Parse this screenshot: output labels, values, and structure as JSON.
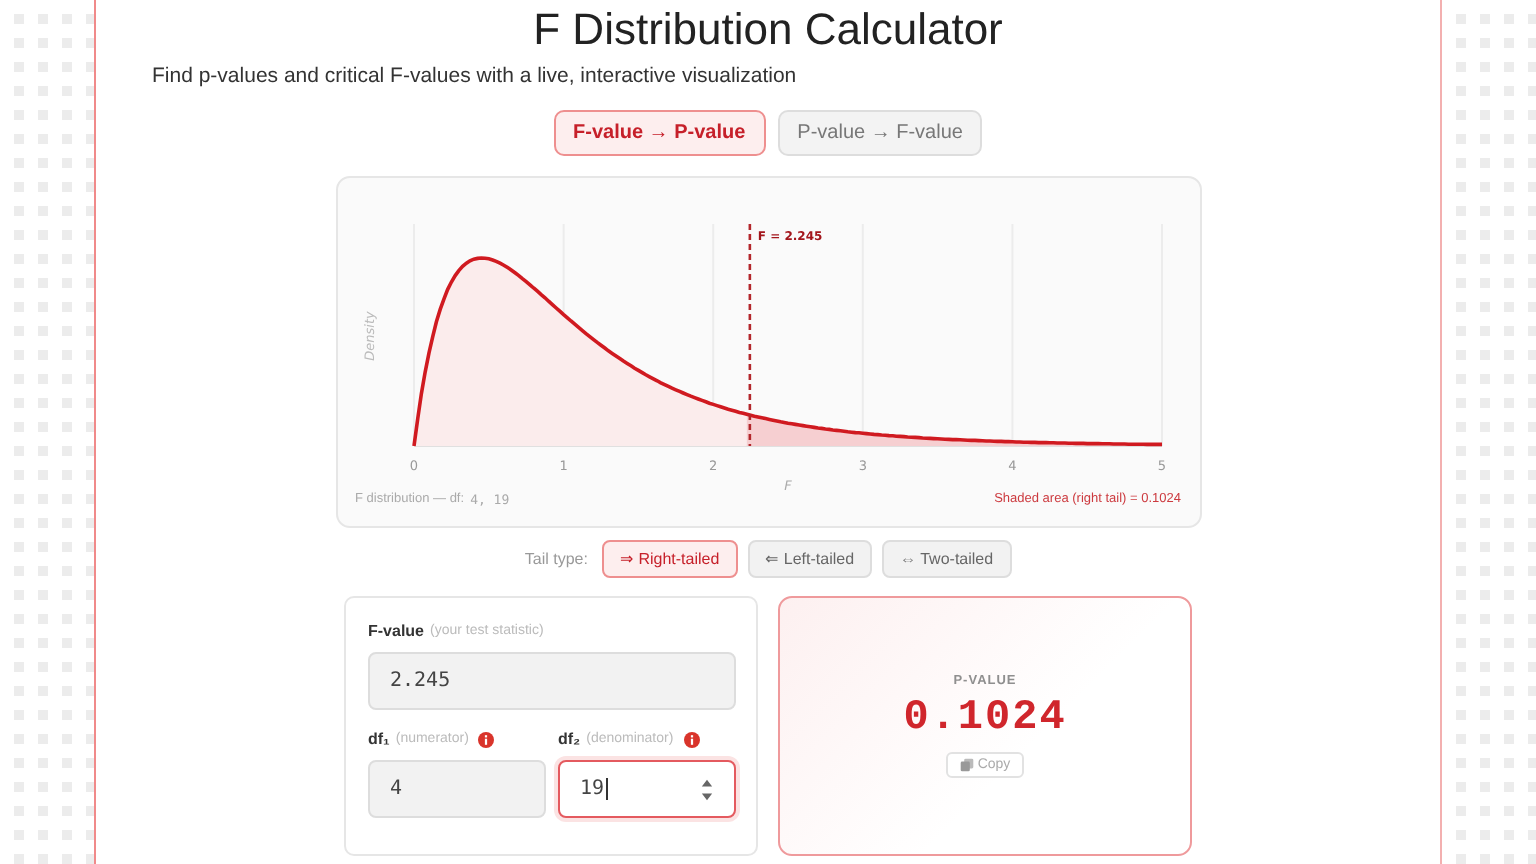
{
  "title": "F Distribution Calculator",
  "subtitle": "Find p-values and critical F-values with a live, interactive visualization",
  "modes": [
    {
      "label": "F-value → P-value",
      "selected": true
    },
    {
      "label": "P-value → F-value",
      "selected": false
    }
  ],
  "chart": {
    "xlabel": "F",
    "ylabel": "Density",
    "x_tick_labels": [
      "0",
      "1",
      "2",
      "3",
      "4",
      "5"
    ],
    "marker_label": "F = 2.245",
    "footer_label": "F distribution — df:",
    "footer_df": "4, 19",
    "shaded_label": "Shaded area (right tail) = 0.1024"
  },
  "tail": {
    "label": "Tail type:",
    "options": [
      {
        "label": "⇒ Right-tailed",
        "selected": true
      },
      {
        "label": "⇐ Left-tailed",
        "selected": false
      },
      {
        "label": "⇔ Two-tailed",
        "selected": false
      }
    ]
  },
  "inputs": {
    "f_label": "F-value",
    "f_hint": "(your test statistic)",
    "f_value": "2.245",
    "df1_label": "df₁",
    "df1_hint": "(numerator)",
    "df1_value": "4",
    "df2_label": "df₂",
    "df2_hint": "(denominator)",
    "df2_value": "19",
    "df2_focused": true
  },
  "result": {
    "label": "P-VALUE",
    "value": "0.1024",
    "copy": "Copy"
  }
}
